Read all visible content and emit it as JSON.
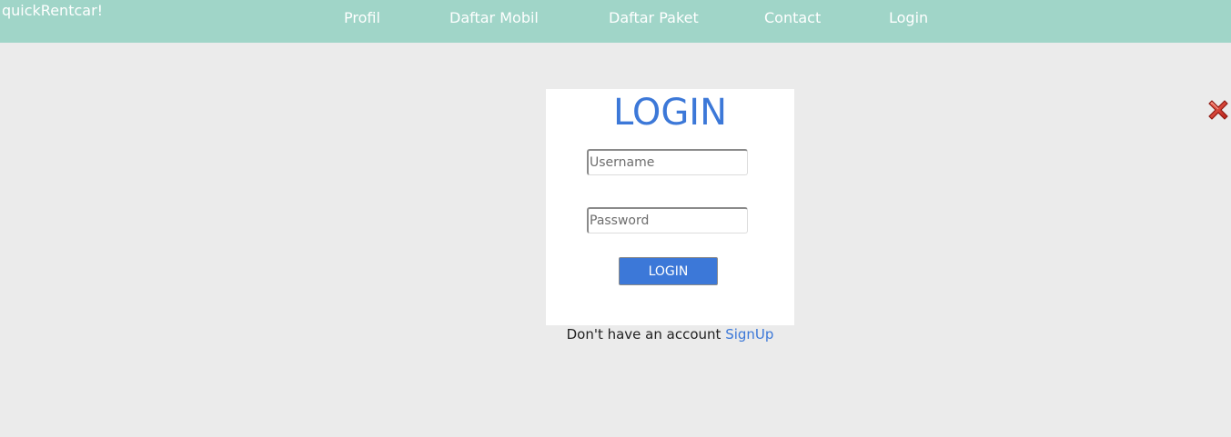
{
  "navbar": {
    "brand": "quickRentcar!",
    "links": [
      "Profil",
      "Daftar Mobil",
      "Daftar Paket",
      "Contact",
      "Login"
    ],
    "background": "#a0d5c8"
  },
  "close_button": {
    "icon": "close-x-icon",
    "color": "#d9312b"
  },
  "login_form": {
    "title": "LOGIN",
    "username_placeholder": "Username",
    "password_placeholder": "Password",
    "submit_label": "LOGIN",
    "accent_color": "#3c78d8"
  },
  "signup": {
    "prompt": "Don't have an account",
    "link_label": "SignUp"
  }
}
